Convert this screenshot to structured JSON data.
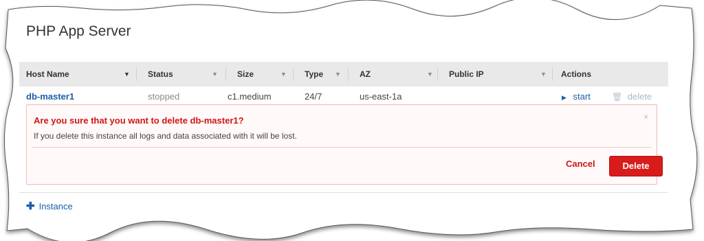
{
  "page": {
    "title": "PHP App Server"
  },
  "table": {
    "columns": [
      {
        "label": "Host Name"
      },
      {
        "label": "Status"
      },
      {
        "label": "Size"
      },
      {
        "label": "Type"
      },
      {
        "label": "AZ"
      },
      {
        "label": "Public IP"
      },
      {
        "label": "Actions"
      }
    ],
    "rows": [
      {
        "host_name": "db-master1",
        "status": "stopped",
        "size": "c1.medium",
        "type": "24/7",
        "az": "us-east-1a",
        "public_ip": "",
        "actions": {
          "start": "start",
          "delete": "delete"
        }
      }
    ]
  },
  "confirm_dialog": {
    "title": "Are you sure that you want to delete db-master1?",
    "message": "If you delete this instance all logs and data associated with it will be lost.",
    "close_glyph": "×",
    "cancel_label": "Cancel",
    "delete_label": "Delete"
  },
  "footer": {
    "add_instance_label": "Instance"
  },
  "icons": {
    "sort_caret": "sort-caret-icon",
    "start": "play-icon",
    "delete": "trash-icon",
    "close": "close-icon",
    "add": "plus-icon"
  },
  "colors": {
    "link": "#1a5fa8",
    "danger": "#d01515",
    "delete_button": "#d81c1c",
    "header_bg": "#e9e9e9"
  }
}
